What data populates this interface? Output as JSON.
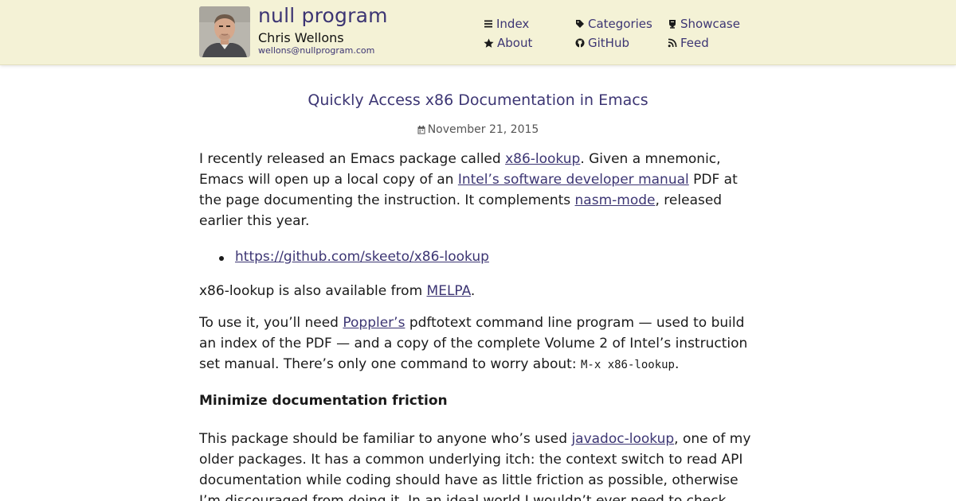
{
  "header": {
    "site_title": "null program",
    "author_name": "Chris Wellons",
    "author_email": "wellons@nullprogram.com",
    "nav": [
      {
        "label": "Index",
        "icon": "list-icon"
      },
      {
        "label": "Categories",
        "icon": "tag-icon"
      },
      {
        "label": "Showcase",
        "icon": "trophy-icon"
      },
      {
        "label": "About",
        "icon": "star-icon"
      },
      {
        "label": "GitHub",
        "icon": "github-icon"
      },
      {
        "label": "Feed",
        "icon": "rss-icon"
      }
    ]
  },
  "post": {
    "title": "Quickly Access x86 Documentation in Emacs",
    "date": "November 21, 2015",
    "p1": {
      "t1": "I recently released an Emacs package called ",
      "l1": "x86-lookup",
      "t2": ". Given a mnemonic, Emacs will open up a local copy of an ",
      "l2": "Intel’s software developer manual",
      "t3": " PDF at the page documenting the instruction. It complements ",
      "l3": "nasm-mode",
      "t4": ", released earlier this year."
    },
    "bullet_link": "https://github.com/skeeto/x86-lookup",
    "p2": {
      "t1": "x86-lookup is also available from ",
      "l1": "MELPA",
      "t2": "."
    },
    "p3": {
      "t1": "To use it, you’ll need ",
      "l1": "Poppler’s",
      "t2": " pdftotext command line program — used to build an index of the PDF — and a copy of the complete Volume 2 of Intel’s instruction set manual. There’s only one command to worry about: ",
      "code": "M-x x86-lookup",
      "t3": "."
    },
    "section_heading": "Minimize documentation friction",
    "p4": {
      "t1": "This package should be familiar to anyone who’s used ",
      "l1": "javadoc-lookup",
      "t2": ", one of my older packages. It has a common underlying itch: the context switch to read API documentation while coding should have as little friction as possible, otherwise I’m discouraged from doing it. In an ideal world I wouldn’t ever need to check"
    }
  },
  "colors": {
    "header_bg": "#f4f2d6",
    "link": "#3c3573",
    "text": "#1a1a1a"
  }
}
